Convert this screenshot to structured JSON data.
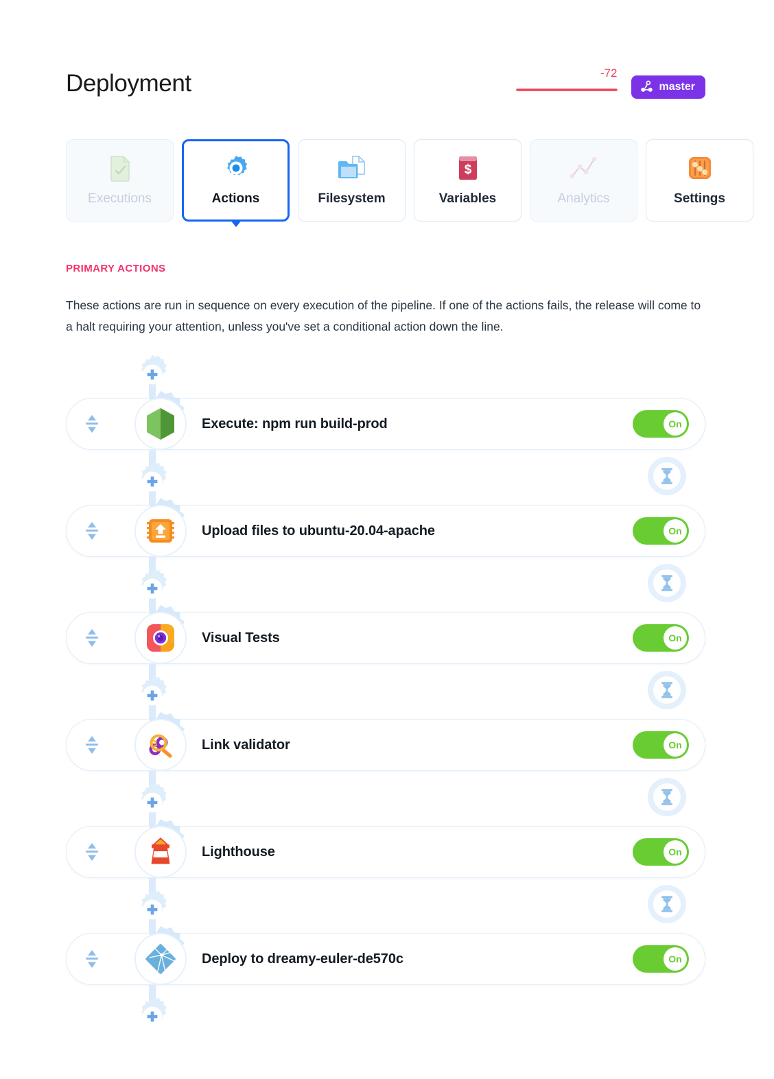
{
  "header": {
    "title": "Deployment",
    "metric_value": "-72",
    "metric_color": "#ef4056",
    "branch": {
      "name": "master",
      "icon": "branch-icon",
      "color": "#7c33e8"
    }
  },
  "tabs": [
    {
      "label": "Executions",
      "icon": "execution-document-check-icon",
      "state": "disabled"
    },
    {
      "label": "Actions",
      "icon": "gear-icon",
      "state": "active"
    },
    {
      "label": "Filesystem",
      "icon": "folder-files-icon",
      "state": "default"
    },
    {
      "label": "Variables",
      "icon": "dollar-book-icon",
      "state": "default"
    },
    {
      "label": "Analytics",
      "icon": "line-chart-icon",
      "state": "disabled"
    },
    {
      "label": "Settings",
      "icon": "sliders-icon",
      "state": "default"
    }
  ],
  "section": {
    "title": "PRIMARY ACTIONS",
    "title_color": "#f2336c",
    "description": "These actions are run in sequence on every execution of the pipeline. If one of the actions fails, the release will come to a halt requiring your attention, unless you've set a conditional action down the line."
  },
  "pipeline": {
    "add_action_label": "+",
    "wait_icon": "hourglass-icon",
    "drag_icon": "drag-updown-icon",
    "toggle_on_label": "On",
    "toggle_on_color": "#69cc33",
    "actions": [
      {
        "label": "Execute: npm run build-prod",
        "icon": "nodejs-hexagon-icon",
        "toggle": "On"
      },
      {
        "label": "Upload files to ubuntu-20.04-apache",
        "icon": "server-upload-icon",
        "toggle": "On"
      },
      {
        "label": "Visual Tests",
        "icon": "visual-tests-icon",
        "toggle": "On"
      },
      {
        "label": "Link validator",
        "icon": "link-validator-icon",
        "toggle": "On"
      },
      {
        "label": "Lighthouse",
        "icon": "lighthouse-icon",
        "toggle": "On"
      },
      {
        "label": "Deploy to dreamy-euler-de570c",
        "icon": "netlify-diamond-icon",
        "toggle": "On"
      }
    ]
  }
}
